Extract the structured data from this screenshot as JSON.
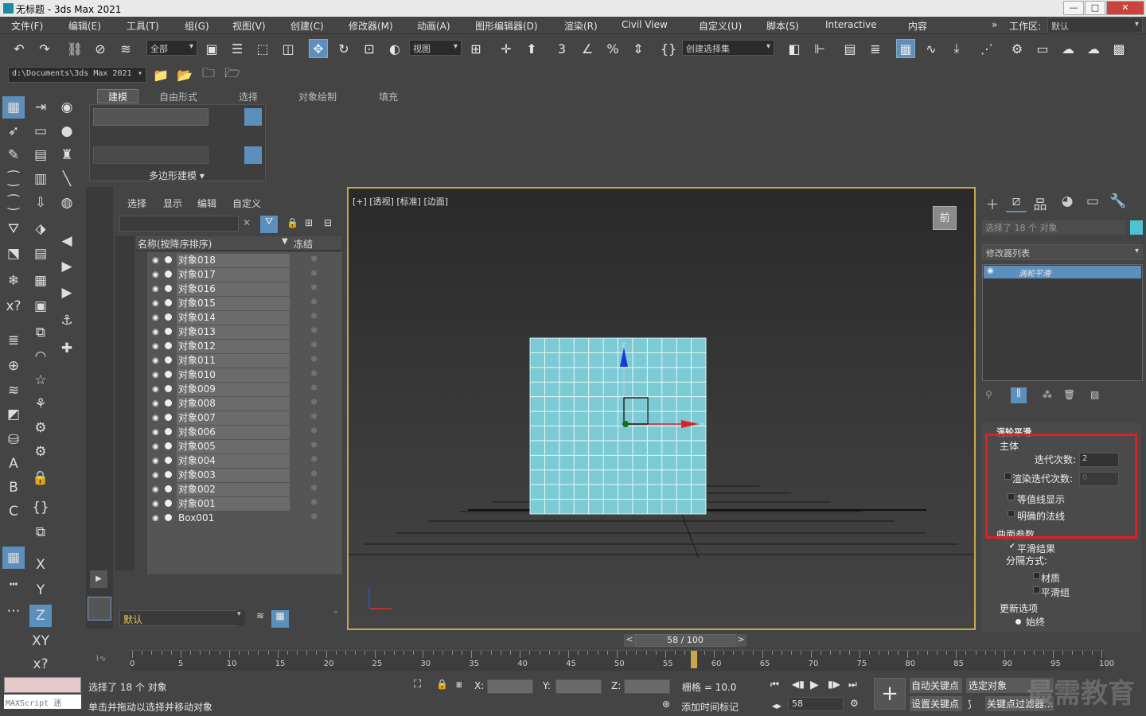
{
  "window": {
    "title": "无标题 - 3ds Max 2021",
    "min": "—",
    "max": "□",
    "close": "✕"
  },
  "menu": [
    "文件(F)",
    "编辑(E)",
    "工具(T)",
    "组(G)",
    "视图(V)",
    "创建(C)",
    "修改器(M)",
    "动画(A)",
    "图形编辑器(D)",
    "渲染(R)",
    "Civil View",
    "自定义(U)",
    "脚本(S)",
    "Interactive",
    "内容"
  ],
  "workspace": {
    "label": "工作区:",
    "value": "默认",
    "arrows": "»"
  },
  "toolbar": {
    "filter": "全部",
    "ref_coord": "视图",
    "selset": "创建选择集"
  },
  "pathbar": {
    "path": "d:\\Documents\\3ds Max 2021"
  },
  "ribbon": {
    "tabs": [
      "建模",
      "自由形式",
      "选择",
      "对象绘制",
      "填充"
    ],
    "panel": "多边形建模 ▾"
  },
  "scene_explorer": {
    "menus": [
      "选择",
      "显示",
      "编辑",
      "自定义"
    ],
    "col_name": "名称(按降序排序)",
    "col_freeze": "冻结",
    "sort_arrow": "▼",
    "rows": [
      "对象018",
      "对象017",
      "对象016",
      "对象015",
      "对象014",
      "对象013",
      "对象012",
      "对象011",
      "对象010",
      "对象009",
      "对象008",
      "对象007",
      "对象006",
      "对象005",
      "对象004",
      "对象003",
      "对象002",
      "对象001",
      "Box001"
    ],
    "layer": "默认",
    "expand": "»",
    "play": "▶",
    "clear": "✕"
  },
  "viewport": {
    "label": "[+] [透视] [标准] [边面]",
    "viewcube": "前",
    "axis_x": "x",
    "axis_z": "z"
  },
  "command_panel": {
    "selected": "选择了 18 个 对象",
    "modlist": "修改器列表",
    "stack_item": "涡轮平滑",
    "rollout_title": "涡轮平滑",
    "main_group": "主体",
    "iterations_label": "迭代次数:",
    "iterations_value": "2",
    "render_iters_label": "渲染迭代次数:",
    "render_iters_value": "0",
    "isoline": "等值线显示",
    "explicit_normals": "明确的法线",
    "surface_group": "曲面参数",
    "smooth_result": "平滑结果",
    "sep_by": "分隔方式:",
    "materials": "材质",
    "smoothing_groups": "平滑组",
    "update_group": "更新选项",
    "always": "始终",
    "check": "✔"
  },
  "timeline": {
    "frame": "58 / 100",
    "ticks": [
      "0",
      "5",
      "10",
      "15",
      "20",
      "25",
      "30",
      "35",
      "40",
      "45",
      "50",
      "55",
      "60",
      "65",
      "70",
      "75",
      "80",
      "85",
      "90",
      "95",
      "100"
    ],
    "current": 58,
    "max": 100,
    "prev": "<",
    "next": ">"
  },
  "status": {
    "maxscript": "MAXScript 迷",
    "selected": "选择了 18 个 对象",
    "hint": "单击并拖动以选择并移动对象",
    "x": "X:",
    "y": "Y:",
    "z": "Z:",
    "grid": "栅格 = 10.0",
    "add_time_tag": "添加时间标记",
    "autokey": "自动关键点",
    "setkey": "设置关键点",
    "selected_obj": "选定对象",
    "key_filter": "关键点过滤器...",
    "frame": "58",
    "watermark": "最需教育"
  }
}
